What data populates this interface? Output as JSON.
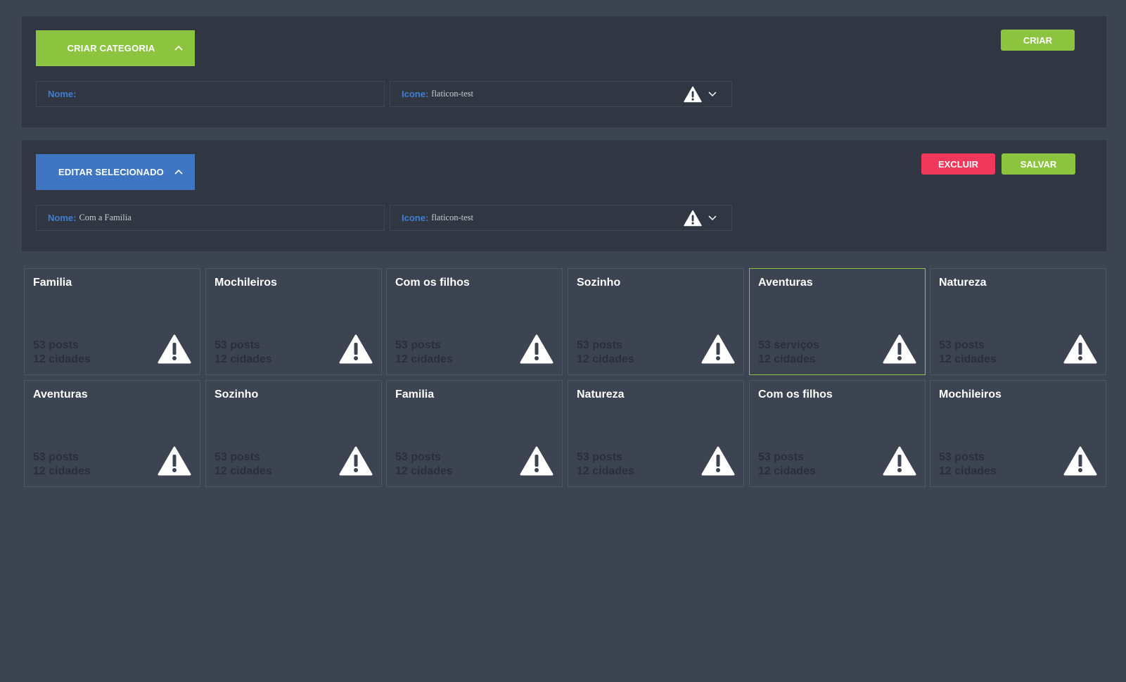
{
  "create_panel": {
    "header_label": "CRIAR CATEGORIA",
    "action_label": "CRIAR",
    "name_label": "Nome:",
    "name_value": "",
    "icon_label": "Icone:",
    "icon_value": "flaticon-test"
  },
  "edit_panel": {
    "header_label": "EDITAR SELECIONADO",
    "delete_label": "EXCLUIR",
    "save_label": "SALVAR",
    "name_label": "Nome:",
    "name_value": "Com a Familia",
    "icon_label": "Icone:",
    "icon_value": "flaticon-test"
  },
  "colors": {
    "accent_green": "#8dc43f",
    "accent_blue": "#3f76c3",
    "danger_red": "#f0385a",
    "background": "#3c4351",
    "panel": "#313643"
  },
  "tiles": [
    {
      "title": "Familia",
      "line1": "53 posts",
      "line2": "12 cidades",
      "icon": "warning-icon"
    },
    {
      "title": "Mochileiros",
      "line1": "53 posts",
      "line2": "12 cidades",
      "icon": "warning-icon"
    },
    {
      "title": "Com os filhos",
      "line1": "53 posts",
      "line2": "12 cidades",
      "icon": "warning-icon"
    },
    {
      "title": "Sozinho",
      "line1": "53 posts",
      "line2": "12 cidades",
      "icon": "warning-icon"
    },
    {
      "title": "Aventuras",
      "line1": "53 serviços",
      "line2": "12 cidades",
      "icon": "warning-icon",
      "selected": true
    },
    {
      "title": "Natureza",
      "line1": "53 posts",
      "line2": "12 cidades",
      "icon": "warning-icon"
    },
    {
      "title": "Aventuras",
      "line1": "53 posts",
      "line2": "12 cidades",
      "icon": "warning-icon"
    },
    {
      "title": "Sozinho",
      "line1": "53 posts",
      "line2": "12 cidades",
      "icon": "warning-icon"
    },
    {
      "title": "Familia",
      "line1": "53 posts",
      "line2": "12 cidades",
      "icon": "warning-icon"
    },
    {
      "title": "Natureza",
      "line1": "53 posts",
      "line2": "12 cidades",
      "icon": "warning-icon"
    },
    {
      "title": "Com os filhos",
      "line1": "53 posts",
      "line2": "12 cidades",
      "icon": "warning-icon"
    },
    {
      "title": "Mochileiros",
      "line1": "53 posts",
      "line2": "12 cidades",
      "icon": "warning-icon"
    }
  ]
}
